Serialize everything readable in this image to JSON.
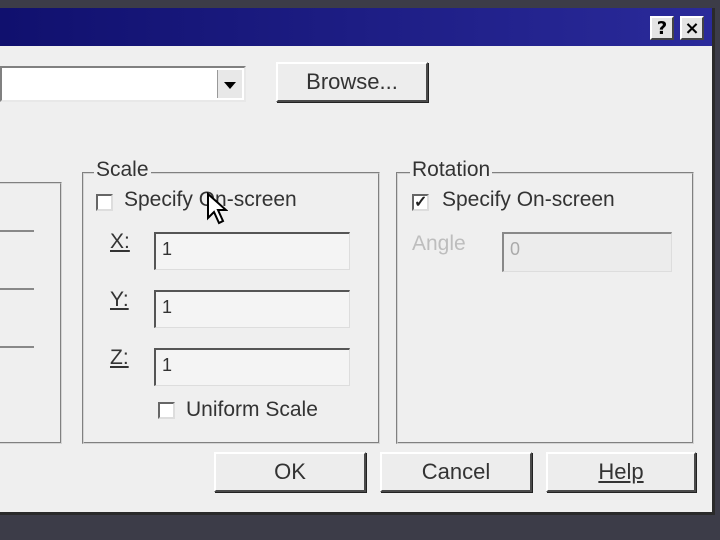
{
  "titlebar": {
    "help_icon": "?",
    "close_icon": "×"
  },
  "browse_button": {
    "label": "Browse..."
  },
  "scale": {
    "title": "Scale",
    "specify_onscreen": {
      "label": "Specify On-screen",
      "checked": false
    },
    "x": {
      "label": "X:",
      "value": "1"
    },
    "y": {
      "label": "Y:",
      "value": "1"
    },
    "z": {
      "label": "Z:",
      "value": "1"
    },
    "uniform_scale": {
      "label": "Uniform Scale",
      "checked": false
    }
  },
  "rotation": {
    "title": "Rotation",
    "specify_onscreen": {
      "label": "Specify On-screen",
      "checked": true,
      "mark": "✓"
    },
    "angle": {
      "label": "Angle",
      "value": "0"
    }
  },
  "buttons": {
    "ok": "OK",
    "cancel": "Cancel",
    "help": "Help"
  },
  "colors": {
    "titlebar": "#10106e",
    "dialog": "#efefef"
  }
}
